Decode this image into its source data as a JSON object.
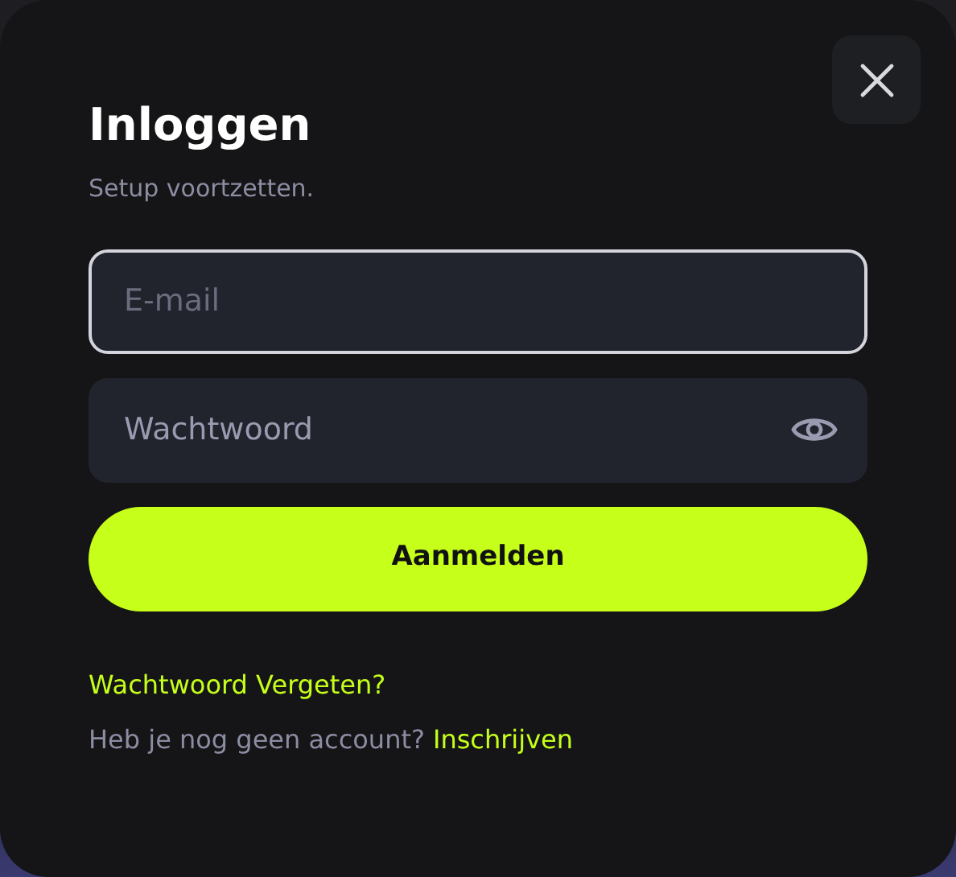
{
  "dialog": {
    "title": "Inloggen",
    "subtitle": "Setup voortzetten."
  },
  "fields": [
    {
      "kind": "text",
      "placeholder": "E-mail",
      "focused": true
    },
    {
      "kind": "password",
      "placeholder": "Wachtwoord",
      "focused": false
    }
  ],
  "submit": "Aanmelden",
  "forgot_link": "Wachtwoord Vergeten?",
  "signup": {
    "prompt": "Heb je nog geen account?",
    "link": "Inschrijven"
  }
}
